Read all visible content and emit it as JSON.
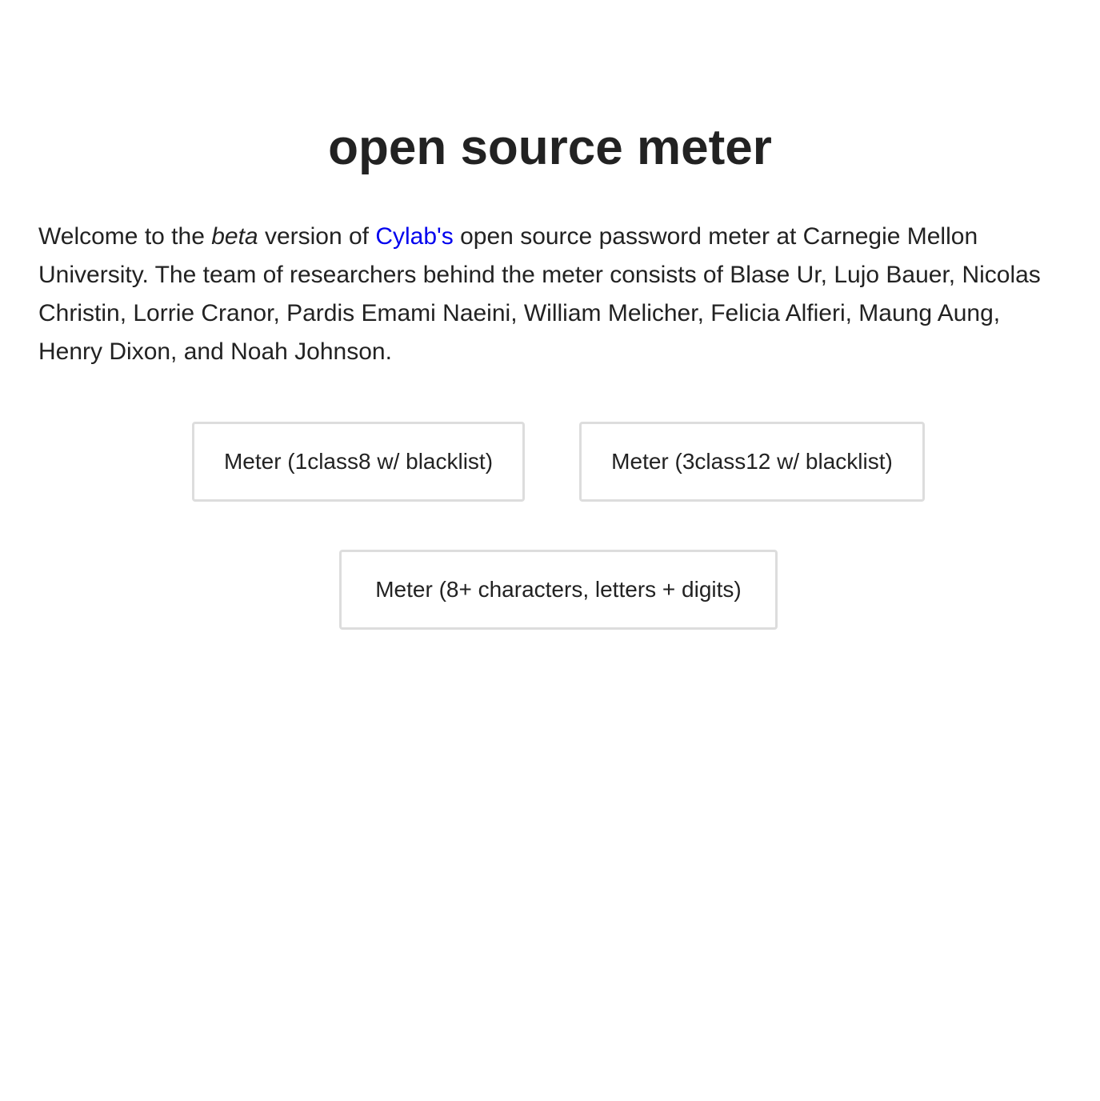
{
  "page": {
    "title": "open source meter"
  },
  "intro": {
    "text_1": "Welcome to the ",
    "emphasis": "beta",
    "text_2": " version of ",
    "link_label": "Cylab's",
    "text_3": " open source password meter at Carnegie Mellon University. The team of researchers behind the meter consists of Blase Ur, Lujo Bauer, Nicolas Christin, Lorrie Cranor, Pardis Emami Naeini, William Melicher, Felicia Alfieri, Maung Aung, Henry Dixon, and Noah Johnson."
  },
  "buttons": [
    {
      "label": "Meter (1class8 w/ blacklist)"
    },
    {
      "label": "Meter (3class12 w/ blacklist)"
    },
    {
      "label": "Meter (8+ characters, letters + digits)"
    }
  ],
  "colors": {
    "text": "#222222",
    "link": "#0000ee",
    "button_border": "#dddddd",
    "background": "#ffffff"
  }
}
